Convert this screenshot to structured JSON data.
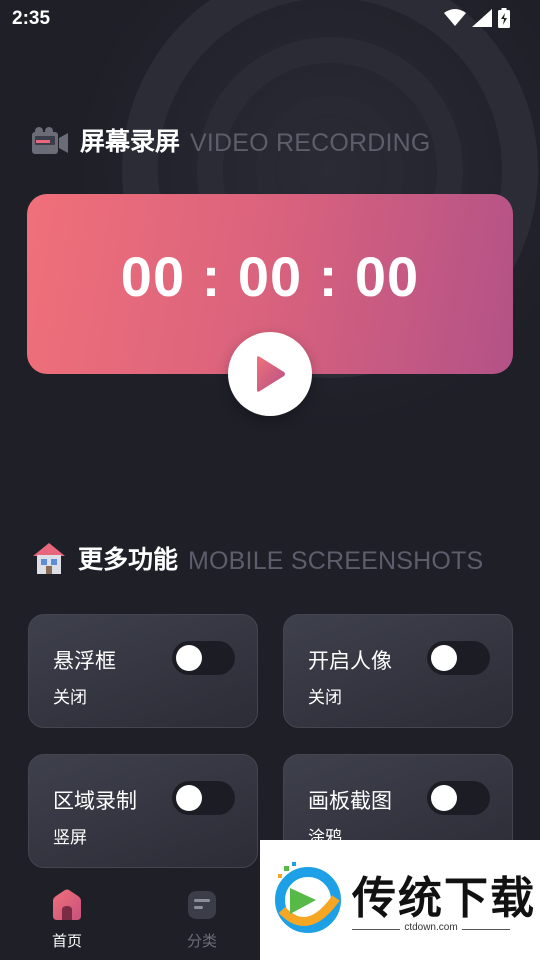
{
  "status_bar": {
    "time": "2:35",
    "icons": [
      "wifi-icon",
      "signal-icon",
      "battery-charging-icon"
    ]
  },
  "recording": {
    "icon": "video-camera-icon",
    "title": "屏幕录屏",
    "subtitle": "VIDEO RECORDING",
    "timer": "00 : 00 : 00",
    "play_icon": "play-icon",
    "gradient": [
      "#f0707a",
      "#b35287"
    ]
  },
  "more": {
    "icon": "house-icon",
    "title": "更多功能",
    "subtitle": "MOBILE SCREENSHOTS",
    "cards": [
      {
        "title": "悬浮框",
        "status": "关闭",
        "toggle_on": false
      },
      {
        "title": "开启人像",
        "status": "关闭",
        "toggle_on": false
      },
      {
        "title": "区域录制",
        "status": "竖屏",
        "toggle_on": false
      },
      {
        "title": "画板截图",
        "status": "涂鸦",
        "toggle_on": false
      }
    ]
  },
  "bottom_nav": {
    "items": [
      {
        "label": "首页",
        "icon": "home-icon",
        "active": true,
        "color": "#ffffff"
      },
      {
        "label": "分类",
        "icon": "category-icon",
        "active": false,
        "color": "#6b6d78"
      }
    ]
  },
  "watermark": {
    "text": "传统下载",
    "url": "ctdown.com"
  },
  "colors": {
    "background": "#1e1f27",
    "accent": "#e8677c",
    "muted_text": "#5c5e6b"
  }
}
